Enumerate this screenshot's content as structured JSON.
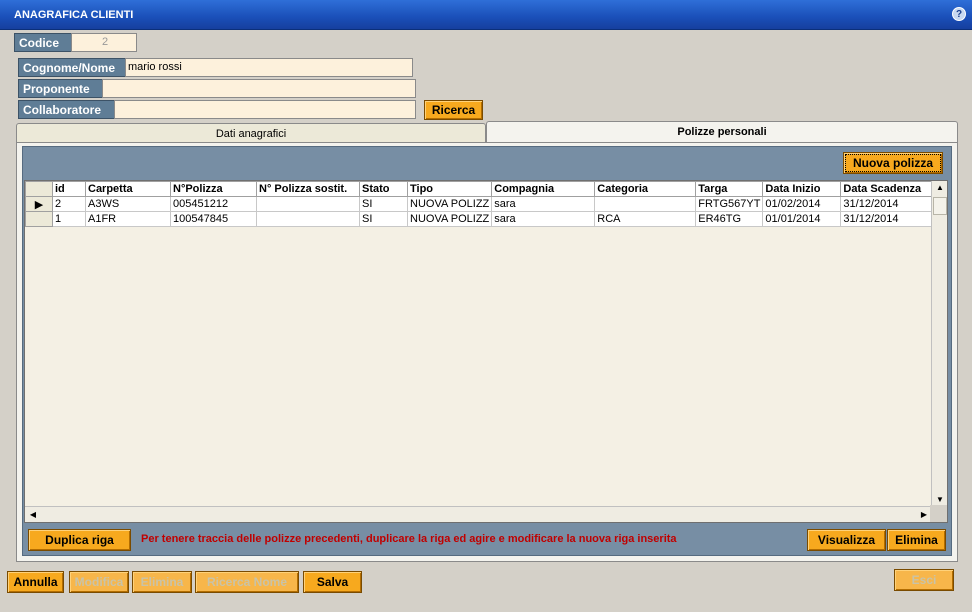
{
  "window": {
    "title": "ANAGRAFICA CLIENTI",
    "help": "?"
  },
  "form": {
    "codice_label": "Codice",
    "codice_value": "2",
    "cognome_label": "Cognome/Nome",
    "cognome_value": "mario rossi",
    "proponente_label": "Proponente",
    "proponente_value": "",
    "collaboratore_label": "Collaboratore",
    "collaboratore_value": "",
    "ricerca_label": "Ricerca"
  },
  "tabs": [
    {
      "label": "Dati anagrafici",
      "active": false
    },
    {
      "label": "Polizze personali",
      "active": true
    }
  ],
  "polizze": {
    "nuova_label": "Nuova polizza",
    "columns": [
      "id",
      "Carpetta",
      "N°Polizza",
      "N° Polizza sostit.",
      "Stato",
      "Tipo",
      "Compagnia",
      "Categoria",
      "Targa",
      "Data Inizio",
      "Data Scadenza"
    ],
    "rows": [
      [
        "2",
        "A3WS",
        "005451212",
        "",
        "SI",
        "NUOVA POLIZZ",
        "sara",
        "",
        "FRTG567YT",
        "01/02/2014",
        "31/12/2014"
      ],
      [
        "1",
        "A1FR",
        "100547845",
        "",
        "SI",
        "NUOVA POLIZZ",
        "sara",
        "RCA",
        "ER46TG",
        "01/01/2014",
        "31/12/2014"
      ]
    ],
    "selected_row": 0,
    "duplica_label": "Duplica riga",
    "message": "Per tenere traccia delle polizze precedenti, duplicare la riga ed agire e modificare la nuova riga inserita",
    "visualizza_label": "Visualizza",
    "elimina_label": "Elimina"
  },
  "footer": {
    "annulla": "Annulla",
    "modifica": "Modifica",
    "elimina": "Elimina",
    "ricerca_nome": "Ricerca Nome",
    "salva": "Salva",
    "esci": "Esci"
  },
  "colors": {
    "accent": "#f7a91e",
    "label_bg": "#5f7d96",
    "title_bar": "#1a4fb8",
    "message": "#c00000"
  }
}
